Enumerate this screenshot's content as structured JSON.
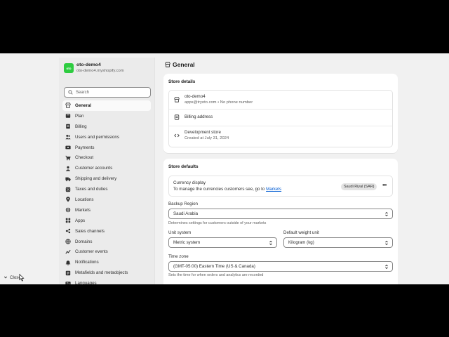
{
  "store": {
    "logo_text": "oto",
    "name": "oto-demo4",
    "domain": "oto-demo4.myshopify.com"
  },
  "search": {
    "placeholder": "Search"
  },
  "nav": [
    {
      "label": "General",
      "icon": "store-icon",
      "active": true
    },
    {
      "label": "Plan",
      "icon": "plan-icon"
    },
    {
      "label": "Billing",
      "icon": "billing-icon"
    },
    {
      "label": "Users and permissions",
      "icon": "users-icon"
    },
    {
      "label": "Payments",
      "icon": "payments-icon"
    },
    {
      "label": "Checkout",
      "icon": "cart-icon"
    },
    {
      "label": "Customer accounts",
      "icon": "person-icon"
    },
    {
      "label": "Shipping and delivery",
      "icon": "truck-icon"
    },
    {
      "label": "Taxes and duties",
      "icon": "tax-icon"
    },
    {
      "label": "Locations",
      "icon": "location-icon"
    },
    {
      "label": "Markets",
      "icon": "globe-icon"
    },
    {
      "label": "Apps",
      "icon": "apps-icon"
    },
    {
      "label": "Sales channels",
      "icon": "channels-icon"
    },
    {
      "label": "Domains",
      "icon": "domain-icon"
    },
    {
      "label": "Customer events",
      "icon": "events-icon"
    },
    {
      "label": "Notifications",
      "icon": "bell-icon"
    },
    {
      "label": "Metafields and metaobjects",
      "icon": "metafields-icon"
    },
    {
      "label": "Languages",
      "icon": "language-icon"
    }
  ],
  "close_label": "Close",
  "page": {
    "title": "General"
  },
  "store_details": {
    "title": "Store details",
    "name": "oto-demo4",
    "contact": "apps@tryoto.com • No phone number",
    "billing": "Billing address",
    "plan_title": "Development store",
    "created": "Created at July 31, 2024"
  },
  "store_defaults": {
    "title": "Store defaults",
    "currency_title": "Currency display",
    "currency_desc": "To manage the currencies customers see, go to",
    "currency_link": "Markets",
    "currency_badge": "Saudi Riyal (SAR)",
    "backup_label": "Backup Region",
    "backup_value": "Saudi Arabia",
    "backup_help": "Determines settings for customers outside of your markets",
    "unit_label": "Unit system",
    "unit_value": "Metric system",
    "weight_label": "Default weight unit",
    "weight_value": "Kilogram (kg)",
    "tz_label": "Time zone",
    "tz_value": "(GMT-05:00) Eastern Time (US & Canada)",
    "tz_help": "Sets the time for when orders and analytics are recorded"
  },
  "colors": {
    "accent_green": "#2ecc40",
    "link": "#005bd3"
  }
}
